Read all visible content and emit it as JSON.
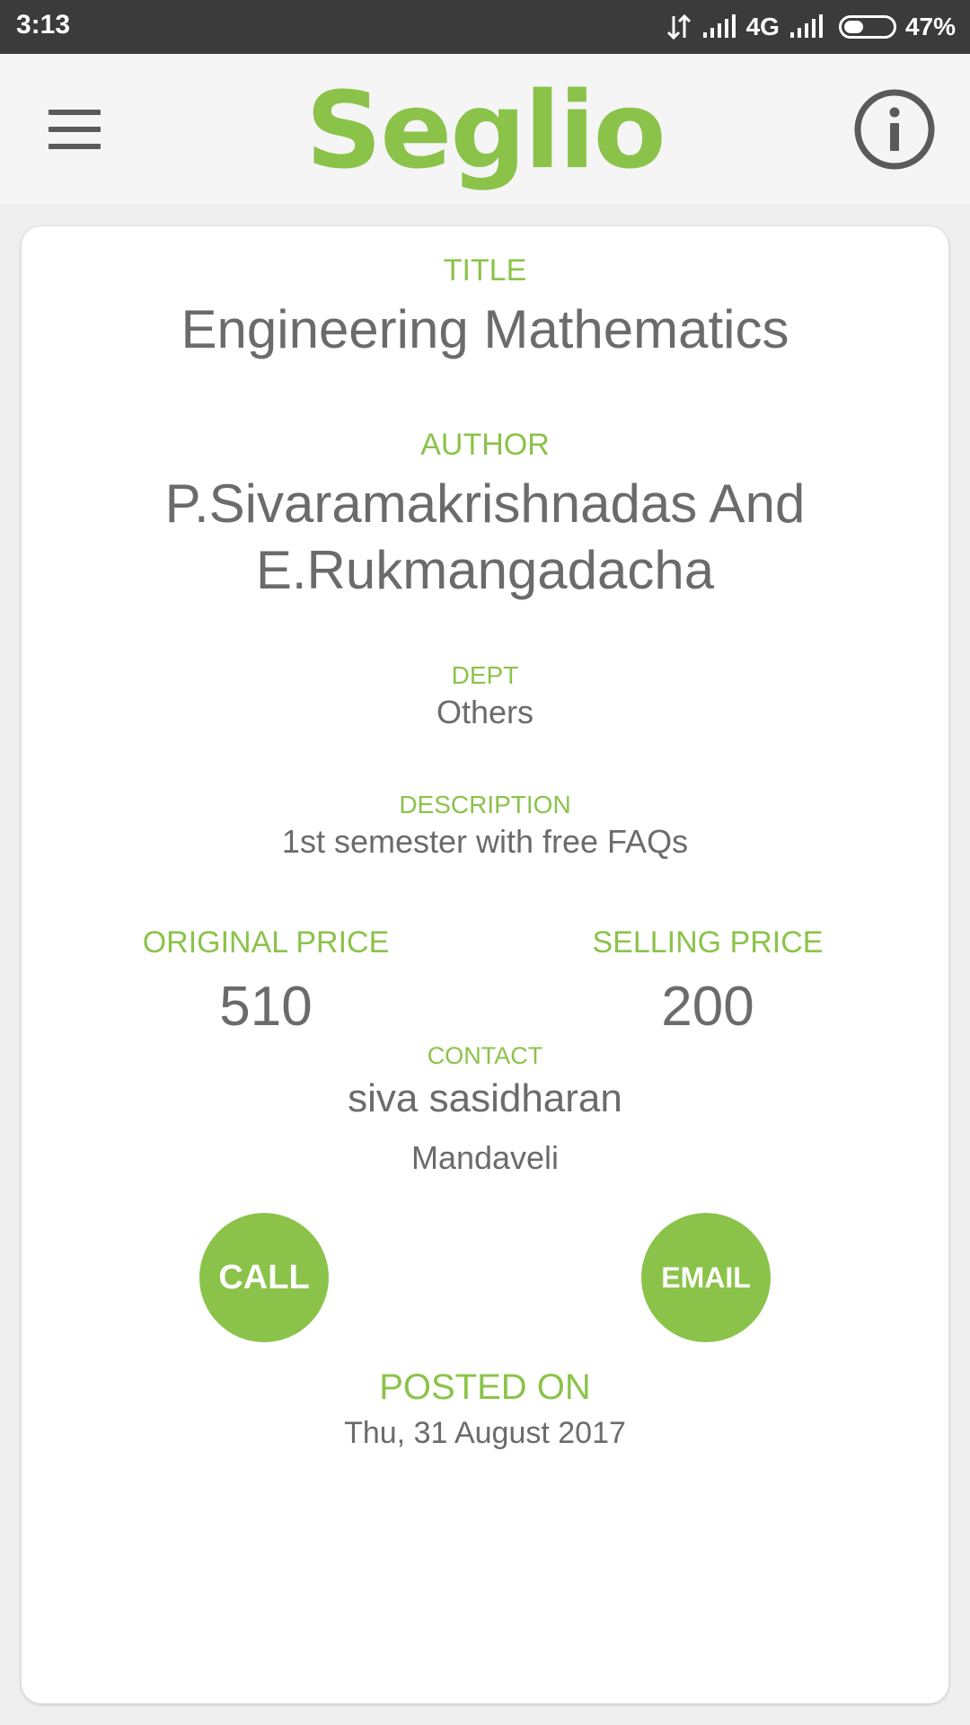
{
  "status_bar": {
    "time": "3:13",
    "network": "4G",
    "battery_percent_label": "47%",
    "battery_level": 0.47
  },
  "app_bar": {
    "logo_text": "Seglio",
    "menu_icon": "hamburger-menu-icon",
    "info_icon": "info-icon",
    "accent_color": "#8bc34a"
  },
  "book": {
    "title_label": "TITLE",
    "title": "Engineering Mathematics",
    "author_label": "AUTHOR",
    "author": "P.Sivaramakrishnadas And E.Rukmangadacha",
    "dept_label": "DEPT",
    "dept": "Others",
    "description_label": "DESCRIPTION",
    "description": "1st semester with free FAQs",
    "original_price_label": "ORIGINAL PRICE",
    "original_price": "510",
    "selling_price_label": "SELLING PRICE",
    "selling_price": "200",
    "contact_label": "CONTACT",
    "contact_name": "siva sasidharan",
    "contact_location": "Mandaveli",
    "posted_label": "POSTED ON",
    "posted_date": "Thu, 31 August 2017"
  },
  "actions": {
    "call_label": "CALL",
    "email_label": "EMAIL"
  }
}
